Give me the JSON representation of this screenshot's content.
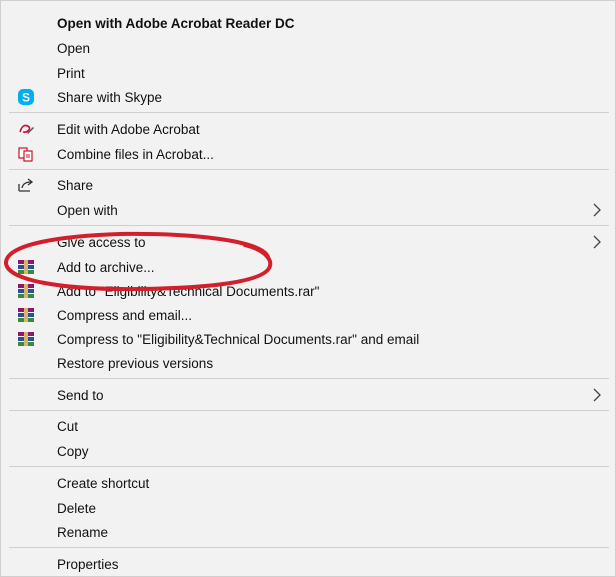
{
  "menu": {
    "items": [
      {
        "label": "Open with Adobe Acrobat Reader DC"
      },
      {
        "label": "Open"
      },
      {
        "label": "Print"
      },
      {
        "label": "Share with Skype"
      },
      {
        "label": "Edit with Adobe Acrobat"
      },
      {
        "label": "Combine files in Acrobat..."
      },
      {
        "label": "Share"
      },
      {
        "label": "Open with"
      },
      {
        "label": "Give access to"
      },
      {
        "label": "Add to archive..."
      },
      {
        "label": "Add to \"Eligibility&Technical Documents.rar\""
      },
      {
        "label": "Compress and email..."
      },
      {
        "label": "Compress to \"Eligibility&Technical Documents.rar\" and email"
      },
      {
        "label": "Restore previous versions"
      },
      {
        "label": "Send to"
      },
      {
        "label": "Cut"
      },
      {
        "label": "Copy"
      },
      {
        "label": "Create shortcut"
      },
      {
        "label": "Delete"
      },
      {
        "label": "Rename"
      },
      {
        "label": "Properties"
      }
    ]
  },
  "colors": {
    "skype": "#00aff0",
    "annotation": "#d21f2b",
    "acrobat": "#c8102e",
    "winrar": "#8b1a6b"
  }
}
